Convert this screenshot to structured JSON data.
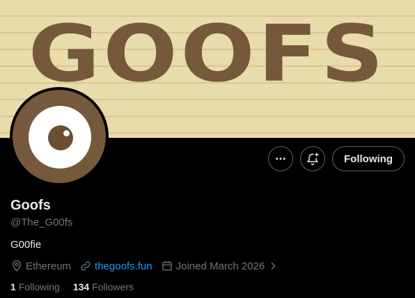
{
  "banner": {
    "text": "GOOFS"
  },
  "profile": {
    "name": "Goofs",
    "handle": "@The_G00fs",
    "bio": "G00fie",
    "location": "Ethereum",
    "website": "thegoofs.fun",
    "joined": "Joined March 2026"
  },
  "actions": {
    "more_icon": "more-horizontal-icon",
    "notify_icon": "bell-plus-icon",
    "following_label": "Following"
  },
  "stats": {
    "following_count": "1",
    "following_label": "Following",
    "followers_count": "134",
    "followers_label": "Followers"
  },
  "colors": {
    "link": "#1d9bf0",
    "muted": "#71767b",
    "banner_brown": "#76593b"
  }
}
